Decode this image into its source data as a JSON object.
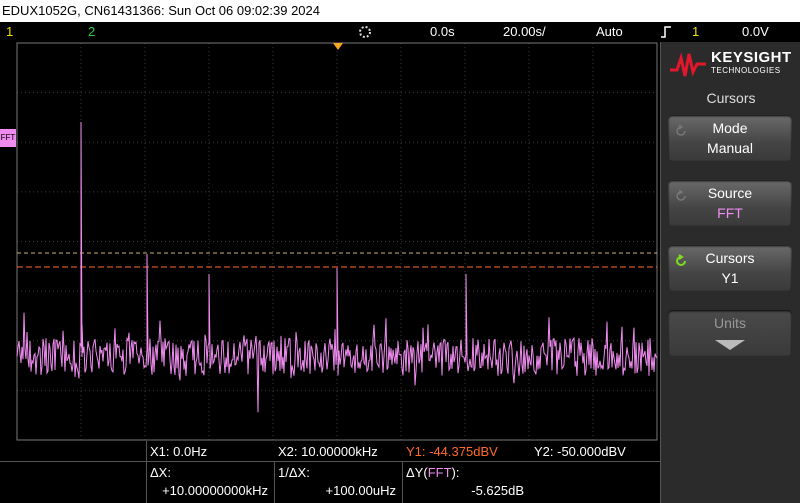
{
  "title_bar": "EDUX1052G, CN61431366: Sun Oct 06 09:02:39 2024",
  "top_bar": {
    "ch1": "1",
    "ch2": "2",
    "time_offset": "0.0s",
    "time_scale": "20.00s/",
    "trigger_mode": "Auto",
    "trig_channel": "1",
    "trig_level": "0.0V"
  },
  "colors": {
    "ch1": "#f0e000",
    "ch2": "#2ecc40",
    "fft": "#f08cf0",
    "y1_cursor": "#ff6a2a",
    "y2_cursor": "#c8b27a",
    "trigger_marker": "#f5a623"
  },
  "fft_marker_label": "FFT",
  "softkeys": {
    "brand": "KEYSIGHT",
    "brand_sub": "TECHNOLOGIES",
    "menu_title": "Cursors",
    "mode": {
      "label": "Mode",
      "value": "Manual"
    },
    "source": {
      "label": "Source",
      "value": "FFT"
    },
    "cursors": {
      "label": "Cursors",
      "value": "Y1"
    },
    "units": {
      "label": "Units"
    }
  },
  "readout": {
    "x1": "X1:  0.0Hz",
    "x2": "X2:  10.00000kHz",
    "y1": "Y1: -44.375dBV",
    "y2": "Y2: -50.000dBV",
    "dx_label": "ΔX:",
    "dx_value": "+10.00000000kHz",
    "inv_dx_label": "1/ΔX:",
    "inv_dx_value": "+100.00uHz",
    "dy_label_prefix": "ΔY(",
    "dy_label_source": "FFT",
    "dy_label_suffix": "):",
    "dy_value": "-5.625dB"
  },
  "icons": {
    "run_indicator": "gear-icon",
    "trigger_slope": "rising-edge-icon",
    "softkey_knob": "rotate-knob-icon",
    "units_expand": "arrow-down-icon"
  }
}
